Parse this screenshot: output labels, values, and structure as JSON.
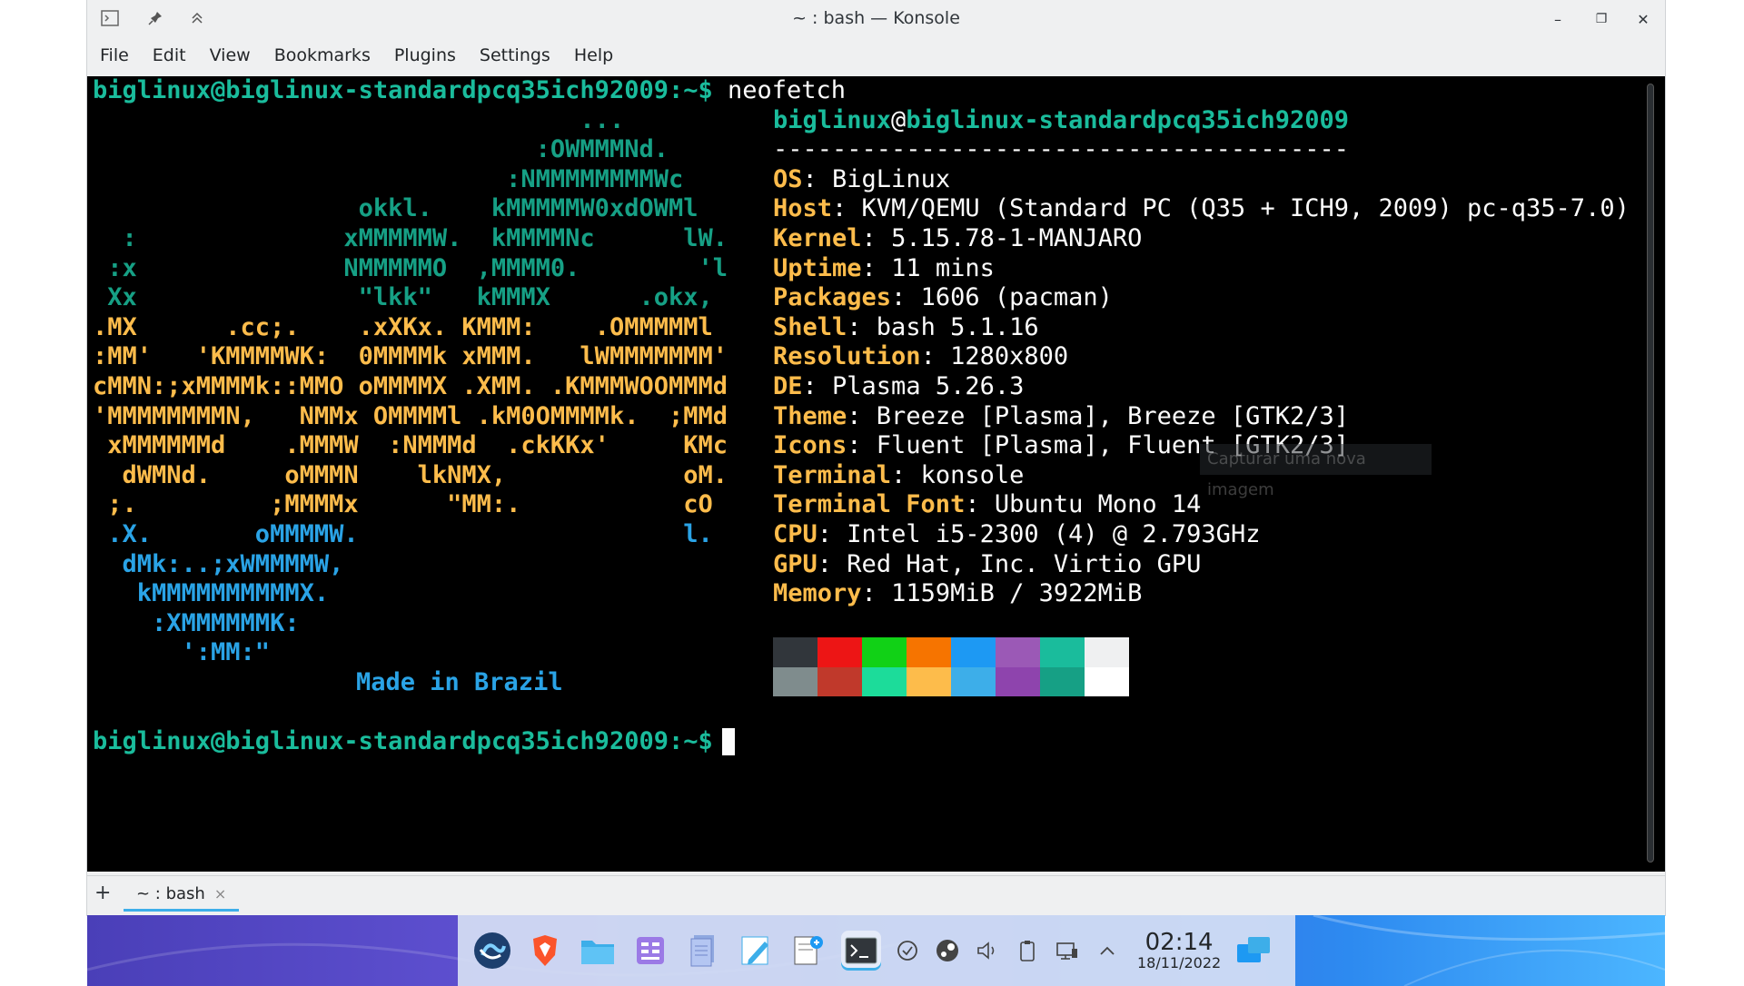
{
  "window": {
    "title": "~ : bash — Konsole",
    "minimize": "–",
    "maximize": "❐",
    "close": "✕"
  },
  "menu": [
    "File",
    "Edit",
    "View",
    "Bookmarks",
    "Plugins",
    "Settings",
    "Help"
  ],
  "terminal": {
    "prompt": "biglinux@biglinux-standardpcq35ich92009:~$",
    "command": " neofetch",
    "user_host_user": "biglinux",
    "user_host_at": "@",
    "user_host_host": "biglinux-standardpcq35ich92009",
    "separator": "---------------------------------------",
    "info": [
      {
        "label": "OS",
        "value": " BigLinux"
      },
      {
        "label": "Host",
        "value": " KVM/QEMU (Standard PC (Q35 + ICH9, 2009) pc-q35-7.0)"
      },
      {
        "label": "Kernel",
        "value": " 5.15.78-1-MANJARO"
      },
      {
        "label": "Uptime",
        "value": " 11 mins"
      },
      {
        "label": "Packages",
        "value": " 1606 (pacman)"
      },
      {
        "label": "Shell",
        "value": " bash 5.1.16"
      },
      {
        "label": "Resolution",
        "value": " 1280x800"
      },
      {
        "label": "DE",
        "value": " Plasma 5.26.3"
      },
      {
        "label": "Theme",
        "value": " Breeze [Plasma], Breeze [GTK2/3]"
      },
      {
        "label": "Icons",
        "value": " Fluent [Plasma], Fluent [GTK2/3]"
      },
      {
        "label": "Terminal",
        "value": " konsole"
      },
      {
        "label": "Terminal Font",
        "value": " Ubuntu Mono 14"
      },
      {
        "label": "CPU",
        "value": " Intel i5-2300 (4) @ 2.793GHz"
      },
      {
        "label": "GPU",
        "value": " Red Hat, Inc. Virtio GPU"
      },
      {
        "label": "Memory",
        "value": " 1159MiB / 3922MiB"
      }
    ],
    "ascii_art": [
      {
        "text": "                                 ...",
        "color": "teal"
      },
      {
        "text": "                              :OWMMMNd.",
        "color": "teal"
      },
      {
        "text": "                            :NMMMMMMMMWc",
        "color": "teal"
      },
      {
        "text": "                  okkl.    kMMMMMW0xdOWMl",
        "color": "teal"
      },
      {
        "text": "  :              xMMMMMW.  kMMMMNc      lW.",
        "color": "teal"
      },
      {
        "text": " :x              NMMMMMO  ,MMMM0.        'l",
        "color": "teal"
      },
      {
        "text": " Xx               \"lkk\"   kMMMX      .okx,",
        "color": "teal"
      },
      {
        "text": ".MX      .cc;.    .xXKx. KMMM:    .OMMMMMl",
        "color": "yellow"
      },
      {
        "text": ":MM'   'KMMMMWK:  0MMMMk xMMM.   lWMMMMMMM'",
        "color": "yellow"
      },
      {
        "text": "cMMN:;xMMMMk::MMO oMMMMX .XMM. .KMMMWOOMMMd",
        "color": "yellow"
      },
      {
        "text": "'MMMMMMMMN,   NMMx OMMMMl .kM0OMMMMk.  ;MMd",
        "color": "yellow"
      },
      {
        "text": " xMMMMMMd    .MMMW  :NMMMd  .ckKKx'     KMc",
        "color": "yellow"
      },
      {
        "text": "  dWMNd.     oMMMN    lkNMX,            oM.",
        "color": "yellow"
      },
      {
        "text": " ;.         ;MMMMx      \"MM:.           cO",
        "color": "yellow"
      },
      {
        "text": " .X.       oMMMMW.                      l.",
        "color": "blue"
      },
      {
        "text": "  dMk:..;xWMMMMW,",
        "color": "blue"
      },
      {
        "text": "   kMMMMMMMMMMX.",
        "color": "blue"
      },
      {
        "text": "    :XMMMMMMK:",
        "color": "blue"
      },
      {
        "text": "      ':MM:\"      ",
        "color": "blue"
      }
    ],
    "made_in": "Made in Brazil",
    "tooltip": "Capturar uma nova imagem",
    "palette_top": [
      "#31363b",
      "#ed1515",
      "#11d116",
      "#f67400",
      "#1d99f3",
      "#9b59b6",
      "#1abc9c",
      "#eff0f1"
    ],
    "palette_bottom": [
      "#7f8c8d",
      "#c0392b",
      "#1cdc9a",
      "#fdbc4b",
      "#3daee9",
      "#8e44ad",
      "#16a085",
      "#ffffff"
    ]
  },
  "tabbar": {
    "new_tab": "+",
    "tab_label": "~ : bash",
    "tab_close": "×"
  },
  "taskbar": {
    "time": "02:14",
    "date": "18/11/2022"
  }
}
